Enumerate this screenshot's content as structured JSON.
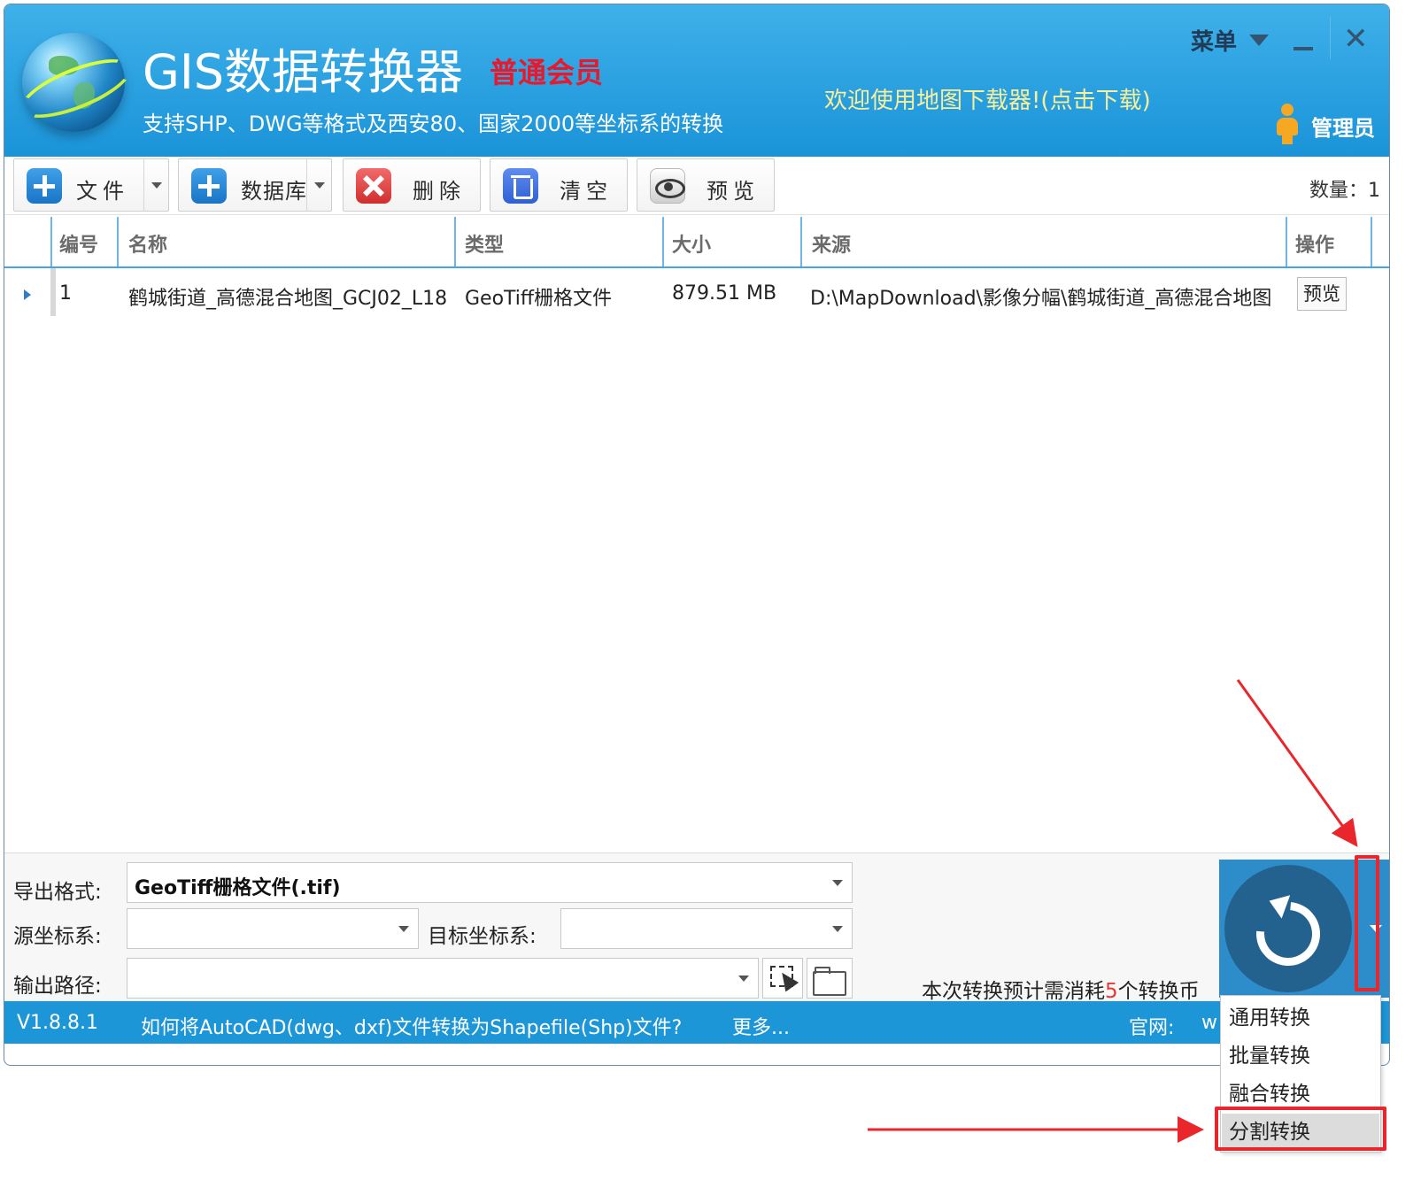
{
  "header": {
    "title": "GIS数据转换器",
    "member_badge": "普通会员",
    "subtitle": "支持SHP、DWG等格式及西安80、国家2000等坐标系的转换",
    "welcome_link": "欢迎使用地图下载器!(点击下载)",
    "menu_label": "菜单",
    "admin_label": "管理员"
  },
  "toolbar": {
    "file_label": "文件",
    "database_label": "数据库",
    "delete_label": "删除",
    "clear_label": "清空",
    "preview_label": "预览",
    "count_text": "数量：1"
  },
  "table": {
    "columns": [
      "编号",
      "名称",
      "类型",
      "大小",
      "来源",
      "操作"
    ],
    "rows": [
      {
        "id": "1",
        "name": "鹤城街道_高德混合地图_GCJ02_L18",
        "type": "GeoTiff栅格文件",
        "size": "879.51 MB",
        "source": "D:\\MapDownload\\影像分幅\\鹤城街道_高德混合地图",
        "action": "预览"
      }
    ]
  },
  "export": {
    "format_label": "导出格式:",
    "format_value": "GeoTiff栅格文件(.tif)",
    "src_crs_label": "源坐标系:",
    "src_crs_value": "",
    "dst_crs_label": "目标坐标系:",
    "dst_crs_value": "",
    "output_label": "输出路径:",
    "output_value": "",
    "cost_prefix": "本次转换预计需消耗",
    "cost_value": "5",
    "cost_suffix": "个转换币"
  },
  "status": {
    "version": "V1.8.8.1",
    "tip": "如何将AutoCAD(dwg、dxf)文件转换为Shapefile(Shp)文件?",
    "more": "更多...",
    "site_label": "官网:",
    "site_value": "w"
  },
  "convert_menu": {
    "items": [
      "通用转换",
      "批量转换",
      "融合转换",
      "分割转换"
    ],
    "highlighted": "分割转换"
  },
  "colors": {
    "header_blue": "#1a93d8",
    "status_blue": "#1d96d8",
    "member_red": "#e8192c",
    "welcome_yellow": "#f7ef9a",
    "annotation_red": "#e8262c"
  }
}
